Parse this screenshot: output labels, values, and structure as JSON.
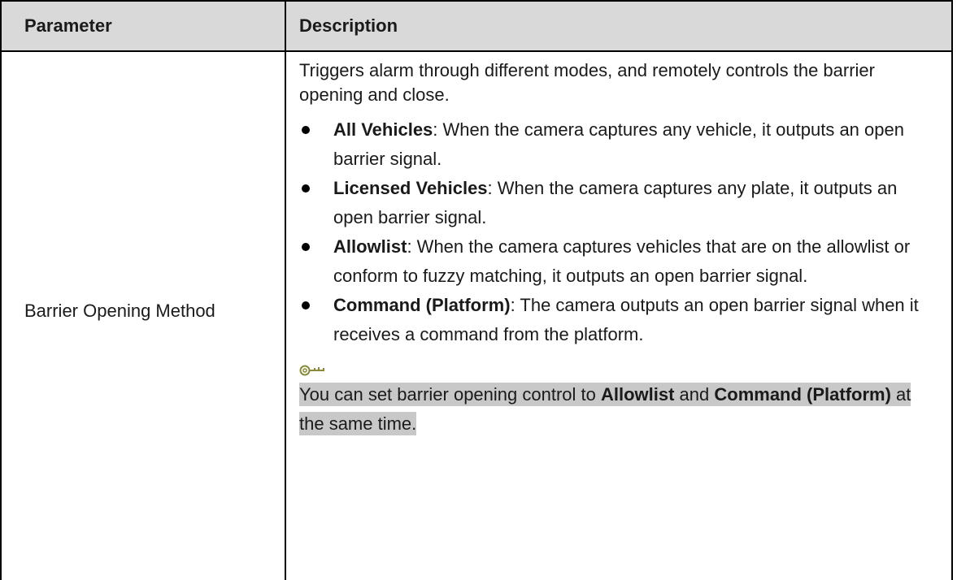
{
  "table": {
    "headers": {
      "parameter": "Parameter",
      "description": "Description"
    },
    "rows": [
      {
        "parameter": "Barrier Opening Method",
        "intro": "Triggers alarm through different modes, and remotely controls the barrier opening and close.",
        "items": [
          {
            "term": "All Vehicles",
            "text": ": When the camera captures any vehicle, it outputs an open barrier signal."
          },
          {
            "term": "Licensed Vehicles",
            "text": ": When the camera captures any plate, it outputs an open barrier signal."
          },
          {
            "term": "Allowlist",
            "text": ": When the camera captures vehicles that are on the allowlist or conform to fuzzy matching, it outputs an open barrier signal."
          },
          {
            "term": "Command (Platform)",
            "text": ": The camera outputs an open barrier signal when it receives a command from the platform."
          }
        ],
        "note": {
          "icon": "key-icon",
          "prefix": "You can set barrier opening control to ",
          "term1": "Allowlist",
          "middle": " and ",
          "term2": "Command (Platform)",
          "suffix": " at the same time."
        }
      }
    ]
  },
  "colors": {
    "header_bg": "#d9d9d9",
    "note_highlight": "#c8c8c8",
    "icon": "#8a8a3a"
  }
}
